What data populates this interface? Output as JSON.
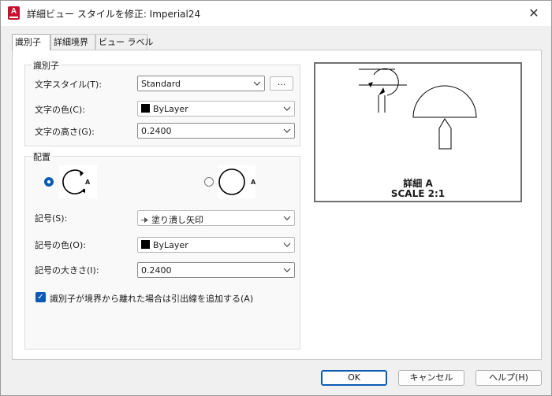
{
  "window": {
    "title": "詳細ビュー スタイルを修正: Imperial24",
    "app_icon_letter": "A",
    "close_glyph": "✕"
  },
  "tabs": [
    {
      "label": "識別子",
      "active": true
    },
    {
      "label": "詳細境界",
      "active": false
    },
    {
      "label": "ビュー ラベル",
      "active": false
    }
  ],
  "identifier_group": {
    "title": "識別子",
    "text_style_label": "文字スタイル(T):",
    "text_style_value": "Standard",
    "browse_label": "...",
    "text_color_label": "文字の色(C):",
    "text_color_value": "ByLayer",
    "text_height_label": "文字の高さ(G):",
    "text_height_value": "0.2400"
  },
  "placement_group": {
    "title": "配置",
    "option1_letter": "A",
    "option2_letter": "A",
    "selected_option": 1,
    "symbol_label": "記号(S):",
    "symbol_value": "塗り潰し矢印",
    "symbol_color_label": "記号の色(O):",
    "symbol_color_value": "ByLayer",
    "symbol_size_label": "記号の大きさ(I):",
    "symbol_size_value": "0.2400",
    "leader_checkbox_label": "識別子が境界から離れた場合は引出線を追加する(A)",
    "leader_checked": true
  },
  "preview": {
    "caption_line1": "詳細 A",
    "caption_line2": "SCALE 2:1"
  },
  "buttons": {
    "ok": "OK",
    "cancel": "キャンセル",
    "help": "ヘルプ(H)"
  },
  "colors": {
    "accent": "#0a5bb5",
    "app_icon": "#c8102e"
  }
}
